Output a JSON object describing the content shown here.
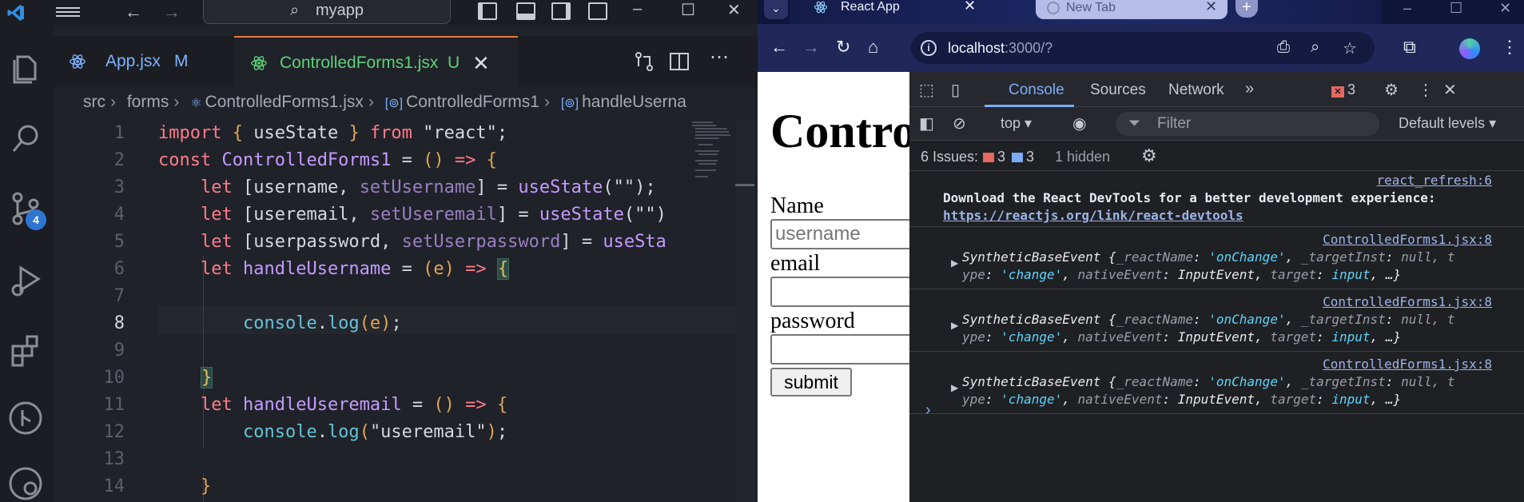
{
  "vscode": {
    "search_label": "myapp",
    "tabs": [
      {
        "label": "App.jsx",
        "mark": "M"
      },
      {
        "label": "ControlledForms1.jsx",
        "mark": "U"
      }
    ],
    "scm_badge": "4",
    "breadcrumb": [
      "src",
      "forms",
      "ControlledForms1.jsx",
      "ControlledForms1",
      "handleUserna"
    ],
    "line_numbers": [
      "1",
      "2",
      "3",
      "4",
      "5",
      "6",
      "7",
      "8",
      "9",
      "10",
      "11",
      "12",
      "13",
      "14"
    ],
    "active_line": "8"
  },
  "chrome": {
    "tabs": [
      {
        "label": "React App"
      },
      {
        "label": "New Tab"
      }
    ],
    "url_host": "localhost",
    "url_rest": ":3000/?",
    "page": {
      "heading": "Contro",
      "name_label": "Name",
      "username_placeholder": "username",
      "email_label": "email",
      "password_label": "password",
      "submit_label": "submit"
    },
    "devtools": {
      "tabs": [
        "Console",
        "Sources",
        "Network"
      ],
      "error_count": "3",
      "context": "top",
      "filter_placeholder": "Filter",
      "levels": "Default levels",
      "issues_label": "6 Issues:",
      "issues_errors": "3",
      "issues_info": "3",
      "issues_hidden": "1 hidden",
      "log": {
        "devtools_src": "react_refresh:6",
        "devtools_msg": "Download the React DevTools for a better development experience:",
        "devtools_link": "https://reactjs.org/link/react-devtools",
        "event_src": "ControlledForms1.jsx:8",
        "event_line1_prefix": "SyntheticBaseEvent {",
        "event_line1_k1": "_reactName",
        "event_line1_v1": "'onChange'",
        "event_line1_k2": "_targetInst",
        "event_line1_v2": "null, t",
        "event_line2_k1": "ype",
        "event_line2_v1": "'change'",
        "event_line2_k2": "nativeEvent",
        "event_line2_v2": "InputEvent",
        "event_line2_k3": "target",
        "event_line2_v3": "input",
        "event_line2_end": ", …}"
      }
    }
  }
}
